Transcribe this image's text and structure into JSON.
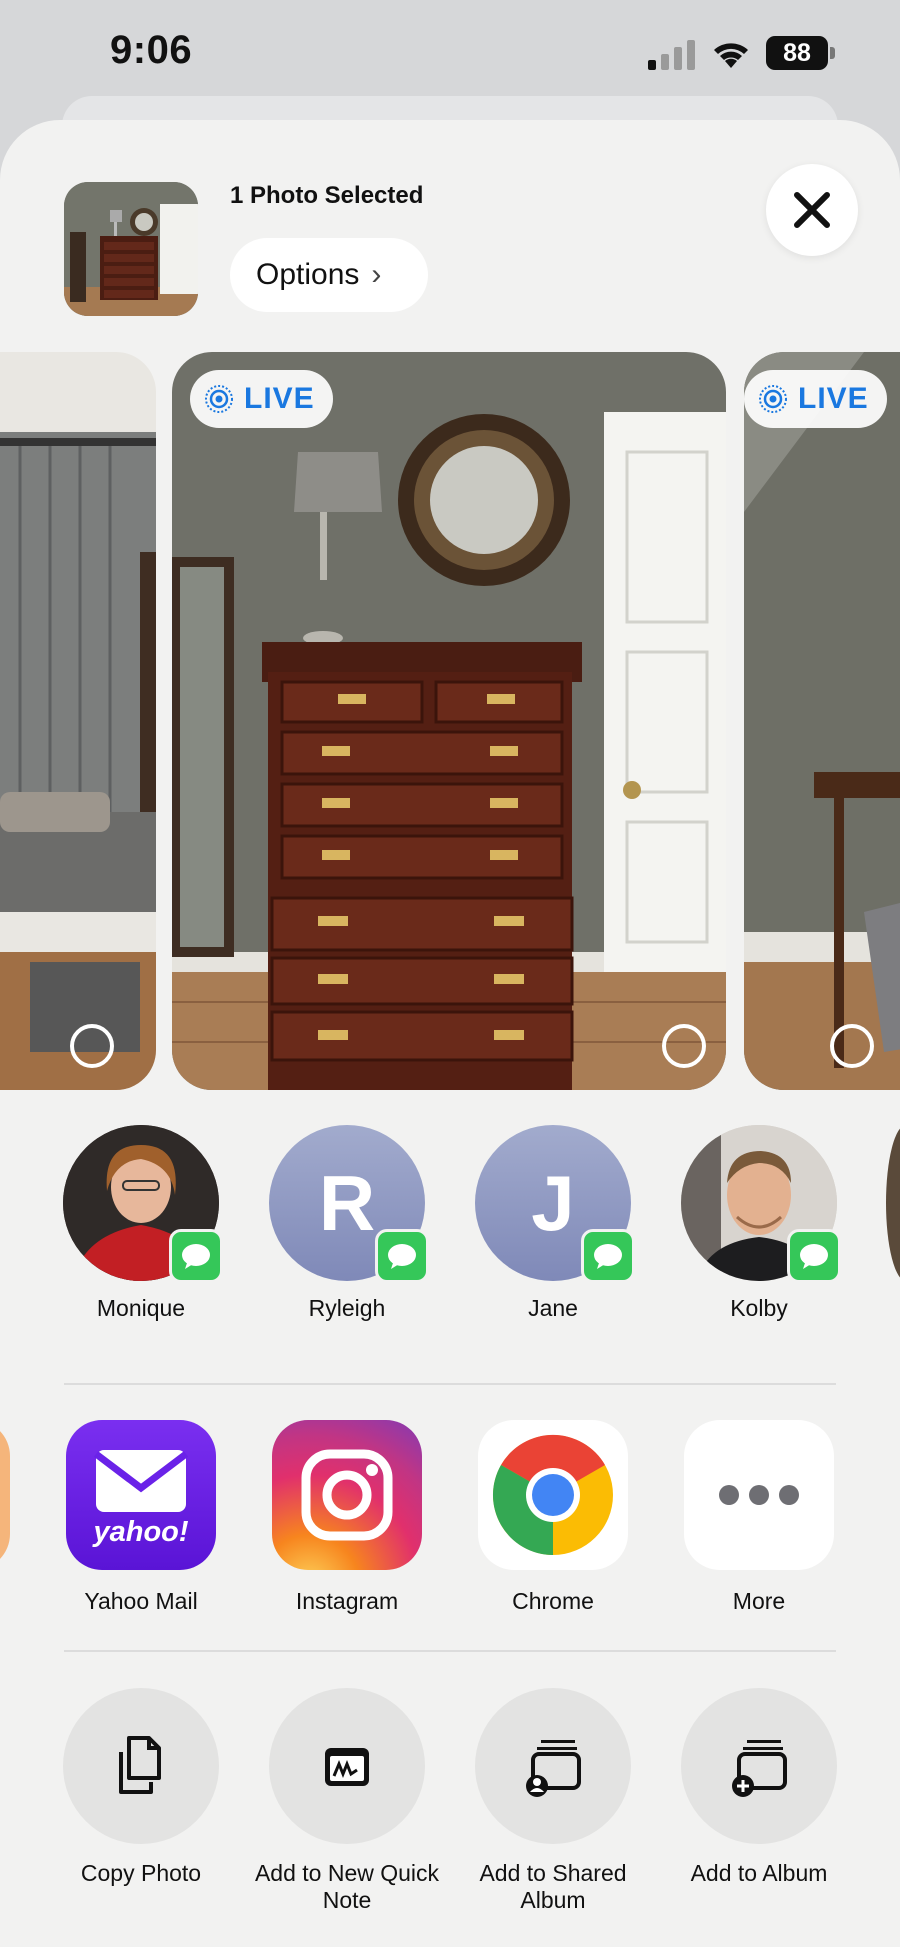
{
  "status_bar": {
    "time": "9:06",
    "battery": "88"
  },
  "header": {
    "title": "1 Photo Selected",
    "options_label": "Options"
  },
  "photos": {
    "live_label": "LIVE"
  },
  "people": [
    {
      "name": "Monique"
    },
    {
      "name": "Ryleigh",
      "initial": "R"
    },
    {
      "name": "Jane",
      "initial": "J"
    },
    {
      "name": "Kolby"
    }
  ],
  "apps": [
    {
      "name": "Yahoo Mail",
      "icon": "yahoo-mail-icon",
      "wordmark": "yahoo!"
    },
    {
      "name": "Instagram",
      "icon": "instagram-icon"
    },
    {
      "name": "Chrome",
      "icon": "chrome-icon"
    },
    {
      "name": "More",
      "icon": "more-icon"
    }
  ],
  "actions": [
    {
      "label": "Copy Photo",
      "icon": "copy-icon"
    },
    {
      "label": "Add to New Quick Note",
      "icon": "quick-note-icon"
    },
    {
      "label": "Add to Shared Album",
      "icon": "shared-album-icon"
    },
    {
      "label": "Add to Album",
      "icon": "add-album-icon"
    }
  ],
  "colors": {
    "accent": "#1a78e0",
    "messages_green": "#35c759",
    "sheet_bg": "#f2f2f1"
  }
}
